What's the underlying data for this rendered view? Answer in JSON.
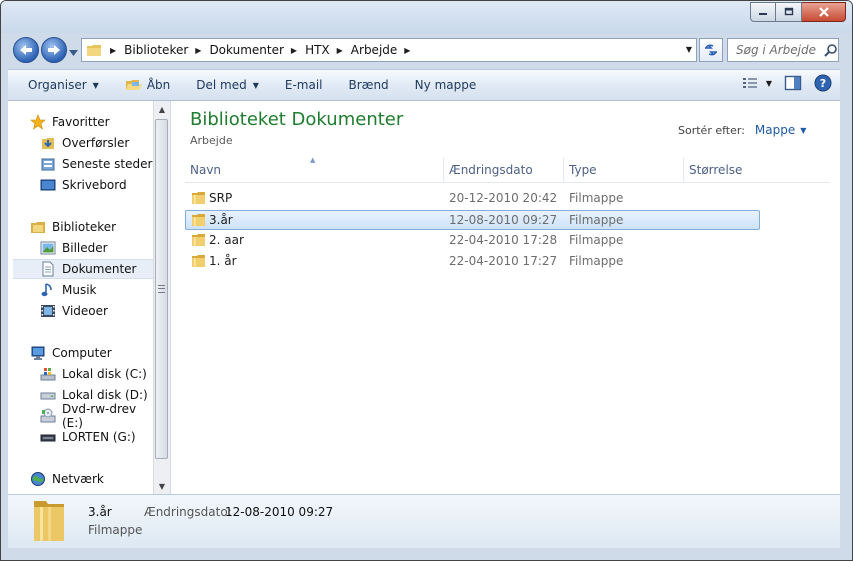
{
  "breadcrumb": [
    "Biblioteker",
    "Dokumenter",
    "HTX",
    "Arbejde"
  ],
  "search": {
    "placeholder": "Søg i Arbejde"
  },
  "toolbar": {
    "organise": "Organiser",
    "open": "Åbn",
    "share": "Del med",
    "email": "E-mail",
    "burn": "Brænd",
    "new_folder": "Ny mappe"
  },
  "sidebar": {
    "favorites": {
      "label": "Favoritter",
      "items": [
        "Overførsler",
        "Seneste steder",
        "Skrivebord"
      ]
    },
    "libraries": {
      "label": "Biblioteker",
      "items": [
        "Billeder",
        "Dokumenter",
        "Musik",
        "Videoer"
      ],
      "selected": "Dokumenter"
    },
    "computer": {
      "label": "Computer",
      "items": [
        "Lokal disk (C:)",
        "Lokal disk (D:)",
        "Dvd-rw-drev (E:)",
        "LORTEN (G:)"
      ]
    },
    "network": {
      "label": "Netværk"
    }
  },
  "content": {
    "title": "Biblioteket Dokumenter",
    "subtitle": "Arbejde",
    "sort_label": "Sortér efter:",
    "sort_value": "Mappe"
  },
  "columns": [
    "Navn",
    "Ændringsdato",
    "Type",
    "Størrelse"
  ],
  "files": [
    {
      "name": "SRP",
      "date": "20-12-2010 20:42",
      "type": "Filmappe",
      "selected": false
    },
    {
      "name": "3.år",
      "date": "12-08-2010 09:27",
      "type": "Filmappe",
      "selected": true
    },
    {
      "name": "2. aar",
      "date": "22-04-2010 17:28",
      "type": "Filmappe",
      "selected": false
    },
    {
      "name": "1. år",
      "date": "22-04-2010 17:27",
      "type": "Filmappe",
      "selected": false
    }
  ],
  "details": {
    "name": "3.år",
    "type": "Filmappe",
    "date_label": "Ændringsdato:",
    "date": "12-08-2010 09:27"
  },
  "colors": {
    "title_green": "#1e7d2e",
    "link_blue": "#1f5aa6",
    "header_text": "#4d6185",
    "selection_border": "#84acdd"
  }
}
